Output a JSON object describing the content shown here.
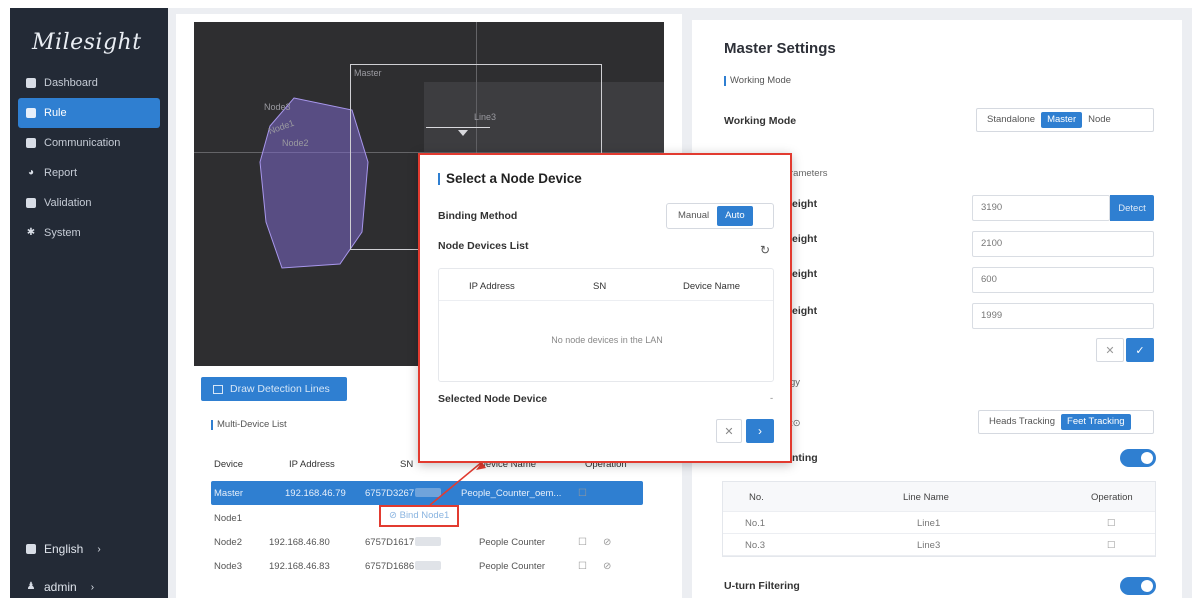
{
  "brand": "Milesight",
  "sidebar": {
    "items": [
      {
        "label": "Dashboard",
        "icon": "dashboard-icon"
      },
      {
        "label": "Rule",
        "icon": "rule-icon",
        "active": true
      },
      {
        "label": "Communication",
        "icon": "communication-icon"
      },
      {
        "label": "Report",
        "icon": "report-icon"
      },
      {
        "label": "Validation",
        "icon": "validation-icon"
      },
      {
        "label": "System",
        "icon": "gear-icon"
      }
    ],
    "language": "English",
    "user": "admin"
  },
  "video": {
    "labels": {
      "node3": "Node3",
      "master": "Master",
      "line3": "Line3",
      "node1": "Node1",
      "node2": "Node2"
    }
  },
  "left": {
    "draw_button": "Draw Detection Lines",
    "multi_device_title": "Multi-Device List",
    "table": {
      "headers": [
        "Device",
        "IP Address",
        "SN",
        "Device Name",
        "Operation"
      ],
      "rows": [
        {
          "device": "Master",
          "ip": "192.168.46.79",
          "sn": "6757D3267",
          "name": "People_Counter_oem...",
          "selected": true
        },
        {
          "device": "Node1",
          "ip": "",
          "sn": "",
          "name": "",
          "bind": "Bind Node1"
        },
        {
          "device": "Node2",
          "ip": "192.168.46.80",
          "sn": "6757D1617",
          "name": "People Counter"
        },
        {
          "device": "Node3",
          "ip": "192.168.46.83",
          "sn": "6757D1686",
          "name": "People Counter"
        }
      ]
    }
  },
  "right": {
    "title": "Master Settings",
    "working_mode_section": "Working Mode",
    "working_mode_label": "Working Mode",
    "working_mode_options": [
      "Standalone",
      "Master",
      "Node"
    ],
    "params_section_fragment": "rameters",
    "params": [
      {
        "label_fragment": "eight",
        "value": "3190"
      },
      {
        "label_fragment": "eight",
        "value": "2100"
      },
      {
        "label_fragment": "eight",
        "value": "600"
      },
      {
        "label_fragment": "eight",
        "value": "1999"
      }
    ],
    "detect": "Detect",
    "strategy_fragment": "gy",
    "tracking_label_fragment": "t",
    "tracking_options": [
      "Heads Tracking",
      "Feet Tracking"
    ],
    "counting_fragment": "nting",
    "line_table": {
      "headers": [
        "No.",
        "Line Name",
        "Operation"
      ],
      "rows": [
        {
          "no": "No.1",
          "name": "Line1"
        },
        {
          "no": "No.3",
          "name": "Line3"
        }
      ]
    },
    "uturn": "U-turn Filtering"
  },
  "modal": {
    "title": "Select a Node Device",
    "binding_method": "Binding Method",
    "binding_options": [
      "Manual",
      "Auto"
    ],
    "node_list": "Node Devices List",
    "table_headers": [
      "IP Address",
      "SN",
      "Device Name"
    ],
    "empty": "No node devices in the LAN",
    "selected_label": "Selected Node Device",
    "selected_value": "-"
  },
  "colors": {
    "accent": "#2f7fd1",
    "sidebar": "#232a36",
    "highlight": "#e23b30"
  }
}
